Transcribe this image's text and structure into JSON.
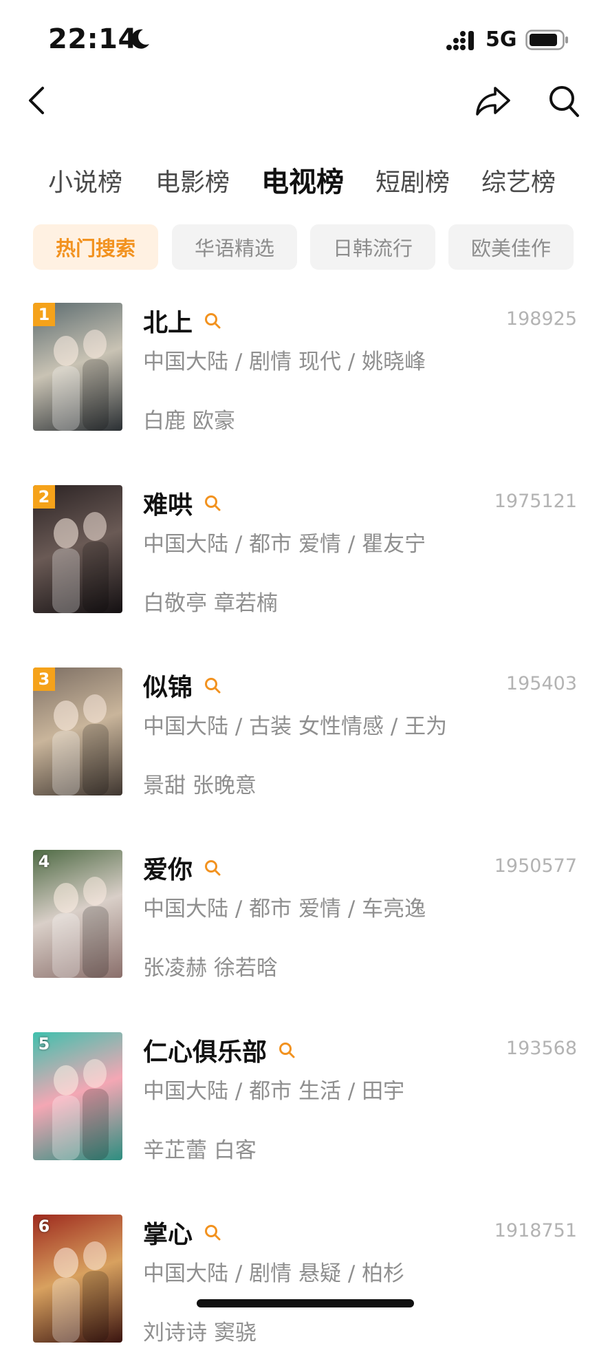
{
  "status_bar": {
    "time": "22:14",
    "network": "5G"
  },
  "tabs": [
    {
      "label": "小说榜",
      "active": false
    },
    {
      "label": "电影榜",
      "active": false
    },
    {
      "label": "电视榜",
      "active": true
    },
    {
      "label": "短剧榜",
      "active": false
    },
    {
      "label": "综艺榜",
      "active": false
    }
  ],
  "chips": [
    {
      "label": "热门搜索",
      "active": true
    },
    {
      "label": "华语精选",
      "active": false
    },
    {
      "label": "日韩流行",
      "active": false
    },
    {
      "label": "欧美佳作",
      "active": false
    }
  ],
  "items": [
    {
      "rank": "1",
      "title": "北上",
      "count": "198925",
      "meta": "中国大陆 / 剧情 现代 / 姚晓峰",
      "cast": "白鹿 欧豪",
      "poster_colors": [
        "#5b6b6f",
        "#c9c3b4",
        "#2a2f33"
      ]
    },
    {
      "rank": "2",
      "title": "难哄",
      "count": "1975121",
      "meta": "中国大陆 / 都市 爱情 / 瞿友宁",
      "cast": "白敬亭 章若楠",
      "poster_colors": [
        "#2b2324",
        "#6a5a55",
        "#141012"
      ]
    },
    {
      "rank": "3",
      "title": "似锦",
      "count": "195403",
      "meta": "中国大陆 / 古装 女性情感 / 王为",
      "cast": "景甜 张晚意",
      "poster_colors": [
        "#7c6e63",
        "#c9b59b",
        "#3f3630"
      ]
    },
    {
      "rank": "4",
      "title": "爱你",
      "count": "1950577",
      "meta": "中国大陆 / 都市 爱情 / 车亮逸",
      "cast": "张凌赫 徐若晗",
      "poster_colors": [
        "#4f6b45",
        "#d9cfc8",
        "#8a6f6b"
      ]
    },
    {
      "rank": "5",
      "title": "仁心俱乐部",
      "count": "193568",
      "meta": "中国大陆 / 都市 生活 / 田宇",
      "cast": "辛芷蕾 白客",
      "poster_colors": [
        "#3fc0ad",
        "#f4a7b4",
        "#2d8e80"
      ]
    },
    {
      "rank": "6",
      "title": "掌心",
      "count": "1918751",
      "meta": "中国大陆 / 剧情 悬疑 / 柏杉",
      "cast": "刘诗诗 窦骁",
      "poster_colors": [
        "#9e2a1e",
        "#d8a15f",
        "#3a1410"
      ]
    }
  ],
  "colors": {
    "accent": "#f2921f",
    "rank_badge": "#f5a21a",
    "muted_text": "#8f8f8f"
  }
}
